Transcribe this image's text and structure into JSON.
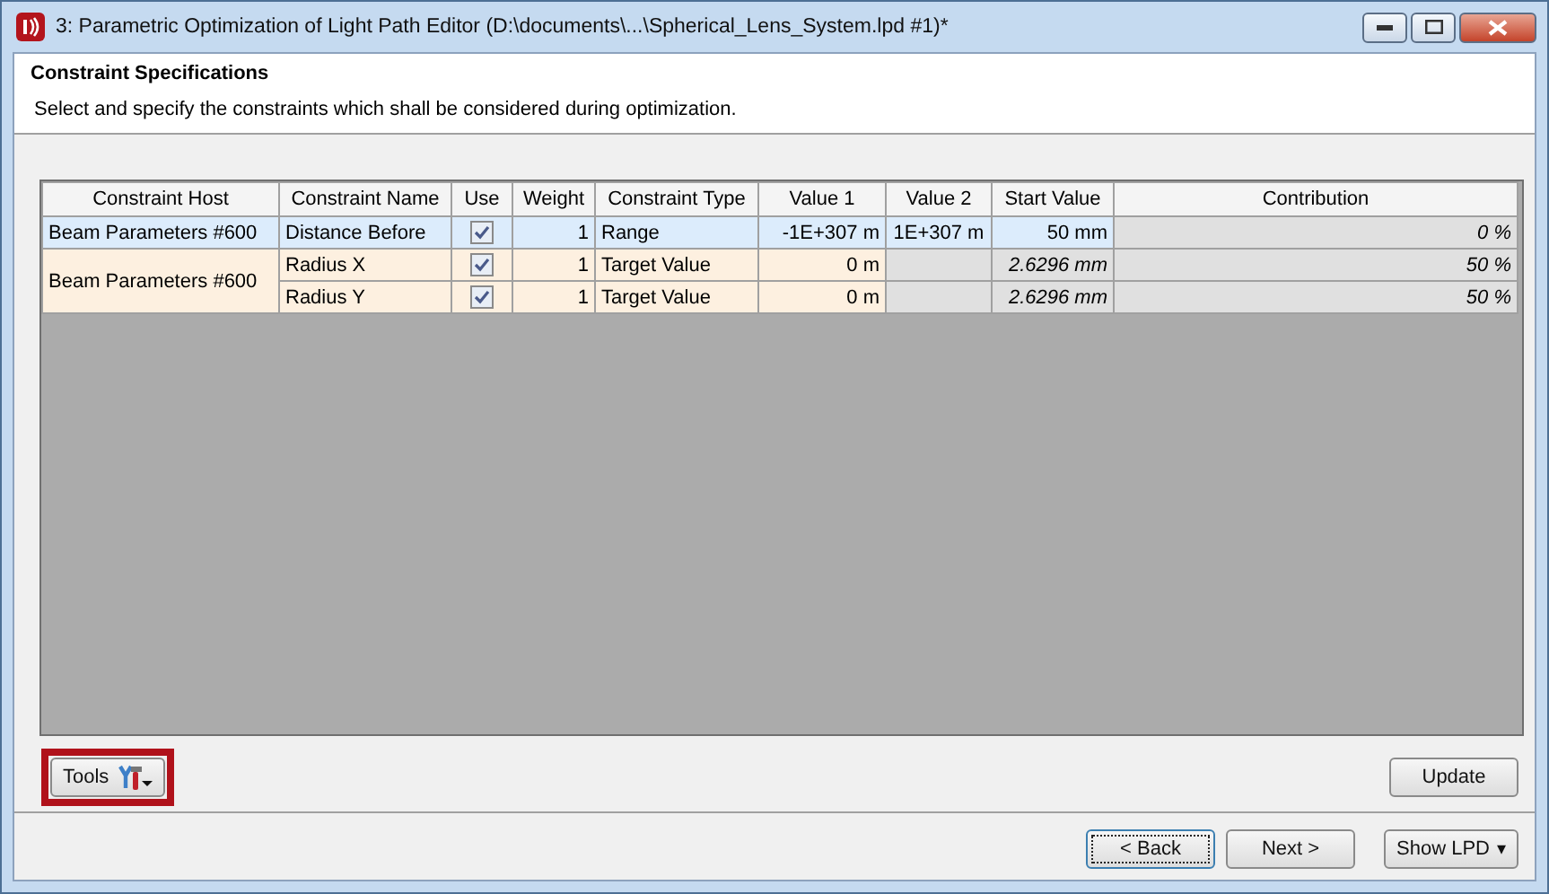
{
  "window": {
    "title": "3: Parametric Optimization of Light Path Editor (D:\\documents\\...\\Spherical_Lens_System.lpd #1)*"
  },
  "header": {
    "title": "Constraint Specifications",
    "description": "Select and specify the constraints which shall be considered during optimization."
  },
  "table": {
    "columns": [
      "Constraint Host",
      "Constraint Name",
      "Use",
      "Weight",
      "Constraint Type",
      "Value 1",
      "Value 2",
      "Start Value",
      "Contribution"
    ],
    "groups": [
      {
        "host": "Beam Parameters #600",
        "rows": [
          {
            "name": "Distance Before",
            "use": true,
            "weight": "1",
            "type": "Range",
            "value_1": "-1E+307 m",
            "value_2": "1E+307 m",
            "start_value": "50 mm",
            "computed": false,
            "contribution": "0 %",
            "selected": true
          }
        ]
      },
      {
        "host": "Beam Parameters #600",
        "rows": [
          {
            "name": "Radius X",
            "use": true,
            "weight": "1",
            "type": "Target Value",
            "value_1": "0 m",
            "start_value": "2.6296 mm",
            "computed": true,
            "contribution": "50 %",
            "selected": false
          },
          {
            "name": "Radius Y",
            "use": true,
            "weight": "1",
            "type": "Target Value",
            "value_1": "0 m",
            "start_value": "2.6296 mm",
            "computed": true,
            "contribution": "50 %",
            "selected": false
          }
        ]
      }
    ]
  },
  "tools_button": {
    "label": "Tools",
    "highlighted": true
  },
  "update_button": "Update",
  "footer_buttons": [
    {
      "label": "< Back",
      "focused": true
    },
    {
      "label": "Next >",
      "focused": false
    }
  ],
  "show_button": {
    "label": "Show LPD",
    "caret": "▾"
  }
}
